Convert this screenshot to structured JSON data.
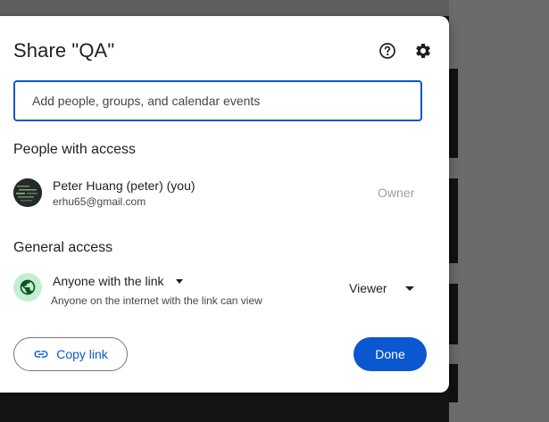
{
  "dialog": {
    "title": "Share \"QA\"",
    "help_icon": "help-circle-icon",
    "settings_icon": "gear-icon"
  },
  "add_people": {
    "placeholder": "Add people, groups, and calendar events",
    "value": ""
  },
  "people_with_access": {
    "heading": "People with access",
    "people": [
      {
        "name": "Peter Huang (peter) (you)",
        "email": "erhu65@gmail.com",
        "role": "Owner"
      }
    ]
  },
  "general_access": {
    "heading": "General access",
    "icon": "globe-icon",
    "access_level": "Anyone with the link",
    "description": "Anyone on the internet with the link can view",
    "role": "Viewer"
  },
  "actions": {
    "copy_link_label": "Copy link",
    "copy_link_icon": "link-icon",
    "done_label": "Done"
  },
  "colors": {
    "primary": "#0b57d0",
    "globe_bg": "#c4eed0",
    "globe_fg": "#0f5223",
    "muted": "#9aa0a6"
  }
}
